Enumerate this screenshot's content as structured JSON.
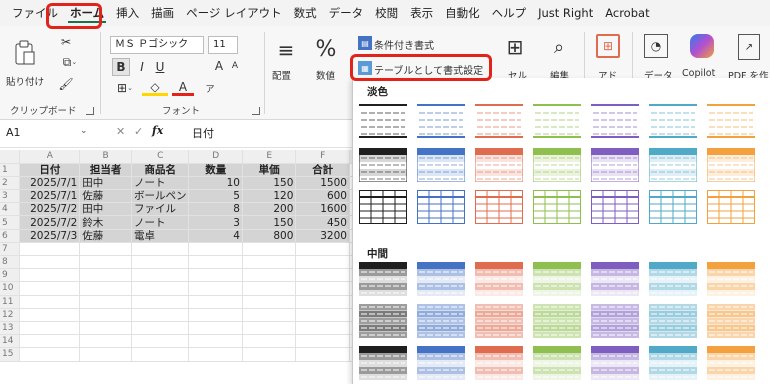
{
  "menu": {
    "tabs": [
      "ファイル",
      "ホーム",
      "挿入",
      "描画",
      "ページ レイアウト",
      "数式",
      "データ",
      "校閲",
      "表示",
      "自動化",
      "ヘルプ",
      "Just Right",
      "Acrobat"
    ],
    "active_tab": "ホーム"
  },
  "ribbon": {
    "clipboard": {
      "paste": "貼り付け",
      "label": "クリップボード"
    },
    "font": {
      "name": "ＭＳ Ｐゴシック",
      "size": "11",
      "label": "フォント",
      "bold": "B",
      "italic": "I",
      "underline": "U",
      "grow": "A",
      "shrink": "A"
    },
    "alignment": {
      "label": "配置"
    },
    "number": {
      "label": "数値",
      "symbol": "%"
    },
    "styles": {
      "conditional": "条件付き書式",
      "as_table": "テーブルとして書式設定"
    },
    "cells": {
      "label": "セル"
    },
    "editing": {
      "label": "編集"
    },
    "addins": {
      "label": "アド"
    },
    "data_analysis": {
      "label": "データ"
    },
    "copilot": {
      "label": "Copilot"
    },
    "pdf": {
      "label": "PDF を作"
    }
  },
  "formula_bar": {
    "name_box": "A1",
    "fx": "fx",
    "value": "日付"
  },
  "sheet": {
    "columns": [
      "A",
      "B",
      "C",
      "D",
      "E",
      "F"
    ],
    "rows": [
      [
        "日付",
        "担当者",
        "商品名",
        "数量",
        "単価",
        "合計"
      ],
      [
        "2025/7/1",
        "田中",
        "ノート",
        "10",
        "150",
        "1500"
      ],
      [
        "2025/7/1",
        "佐藤",
        "ボールペン",
        "5",
        "120",
        "600"
      ],
      [
        "2025/7/2",
        "田中",
        "ファイル",
        "8",
        "200",
        "1600"
      ],
      [
        "2025/7/2",
        "鈴木",
        "ノート",
        "3",
        "150",
        "450"
      ],
      [
        "2025/7/3",
        "佐藤",
        "電卓",
        "4",
        "800",
        "3200"
      ]
    ],
    "row_numbers": [
      "1",
      "2",
      "3",
      "4",
      "5",
      "6",
      "7",
      "8",
      "9",
      "10",
      "11",
      "12",
      "13",
      "14",
      "15"
    ]
  },
  "gallery": {
    "light_label": "淡色",
    "medium_label": "中間",
    "colors": [
      "#1f1f1f",
      "#4472c4",
      "#e06c4f",
      "#8fbf4f",
      "#7e5fbf",
      "#4fa9c7",
      "#f3a03f"
    ]
  }
}
